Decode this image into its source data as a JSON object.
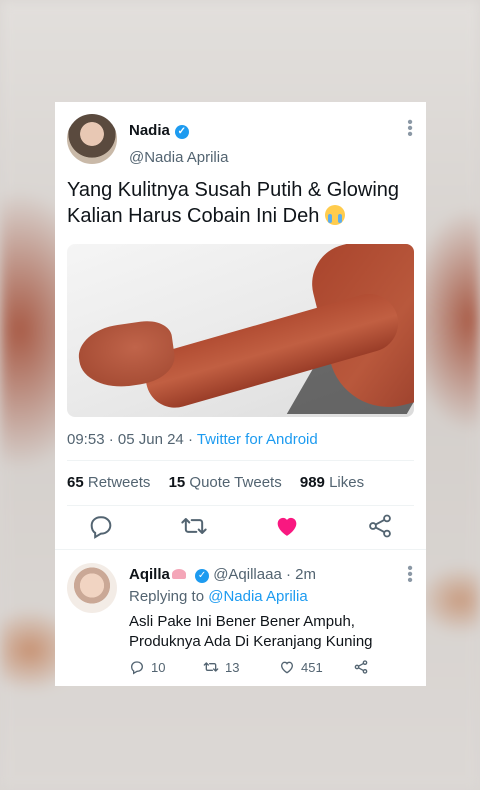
{
  "tweet": {
    "name": "Nadia",
    "handle": "@Nadia Aprilia",
    "text_line1": "Yang Kulitnya Susah Putih & Glowing",
    "text_line2": "Kalian Harus Cobain Ini Deh",
    "time": "09:53",
    "date": "05 Jun 24",
    "source": "Twitter for Android",
    "retweets_count": "65",
    "retweets_label": "Retweets",
    "quotes_count": "15",
    "quotes_label": "Quote Tweets",
    "likes_count": "989",
    "likes_label": "Likes",
    "liked": true
  },
  "reply": {
    "name": "Aqilla",
    "handle": "@Aqillaaa",
    "age": "2m",
    "replying_prefix": "Replying to",
    "replying_mention": "@Nadia Aprilia",
    "text_line1": "Asli Pake Ini Bener Bener Ampuh,",
    "text_line2": "Produknya Ada Di Keranjang Kuning",
    "reply_count": "10",
    "retweet_count": "13",
    "like_count": "451"
  },
  "colors": {
    "accent": "#1d9bf0",
    "like": "#f91880",
    "text": "#0f1419",
    "muted": "#536471"
  },
  "icons": [
    "verified-icon",
    "more-icon",
    "reply-icon",
    "retweet-icon",
    "like-icon",
    "share-icon",
    "crying-emoji-icon",
    "lotus-emoji-icon"
  ]
}
